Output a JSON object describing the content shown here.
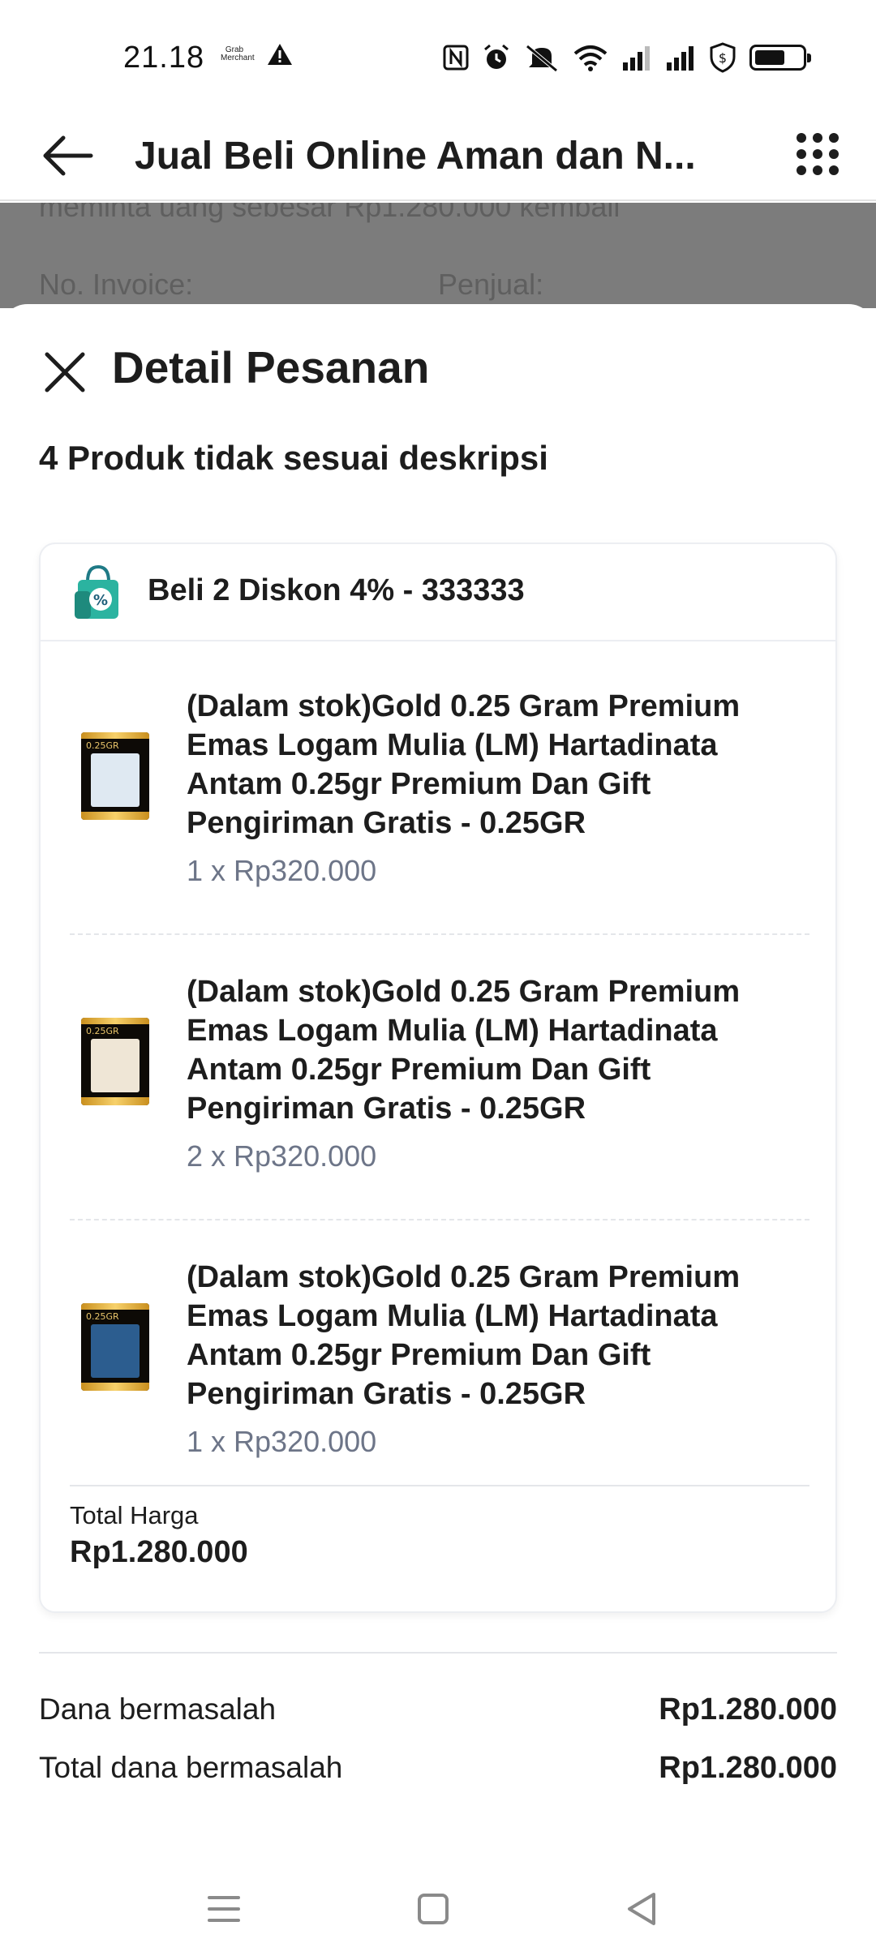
{
  "status_bar": {
    "time": "21.18",
    "grab_logo_text": "Grab Merchant",
    "icons": [
      "warning-icon",
      "nfc-icon",
      "alarm-icon",
      "mute-icon",
      "wifi-icon",
      "signal-icon",
      "signal-icon",
      "vpn-shield-icon",
      "battery-icon"
    ],
    "battery_level": 0.65
  },
  "app_bar": {
    "title": "Jual Beli Online Aman dan N...",
    "back_icon": "arrow-left-icon",
    "menu_icon": "grid-menu-icon"
  },
  "background": {
    "text": "meminta uang sebesar Rp1.280.000 kembali",
    "invoice_label": "No. Invoice:",
    "seller_label": "Penjual:"
  },
  "sheet": {
    "title": "Detail Pesanan",
    "subtitle": "4 Produk tidak sesuai deskripsi",
    "promo": {
      "label": "Beli 2 Diskon 4% - 333333",
      "icon": "discount-bag-icon"
    },
    "products": [
      {
        "name": "(Dalam stok)Gold 0.25 Gram Premium Emas Logam Mulia  (LM)  Hartadinata Antam 0.25gr Premium Dan Gift Pengiriman Gratis - 0.25GR",
        "qty_price": "1 x Rp320.000",
        "thumb_label": "0.25GR",
        "thumb_color": "#dfe9f2"
      },
      {
        "name": "(Dalam stok)Gold 0.25 Gram Premium Emas Logam Mulia  (LM)  Hartadinata Antam 0.25gr Premium Dan Gift Pengiriman Gratis - 0.25GR",
        "qty_price": "2 x Rp320.000",
        "thumb_label": "0.25GR",
        "thumb_color": "#efe6d6"
      },
      {
        "name": "(Dalam stok)Gold 0.25 Gram Premium Emas Logam Mulia  (LM)  Hartadinata Antam 0.25gr Premium Dan Gift Pengiriman Gratis - 0.25GR",
        "qty_price": "1 x Rp320.000",
        "thumb_label": "0.25GR",
        "thumb_color": "#2c5d8f"
      }
    ],
    "total_label": "Total Harga",
    "total_value": "Rp1.280.000",
    "summary": [
      {
        "label": "Dana bermasalah",
        "value": "Rp1.280.000"
      },
      {
        "label": "Total dana bermasalah",
        "value": "Rp1.280.000"
      }
    ]
  },
  "nav_bar": {
    "items": [
      "menu-icon",
      "home-icon",
      "back-triangle-icon"
    ]
  }
}
